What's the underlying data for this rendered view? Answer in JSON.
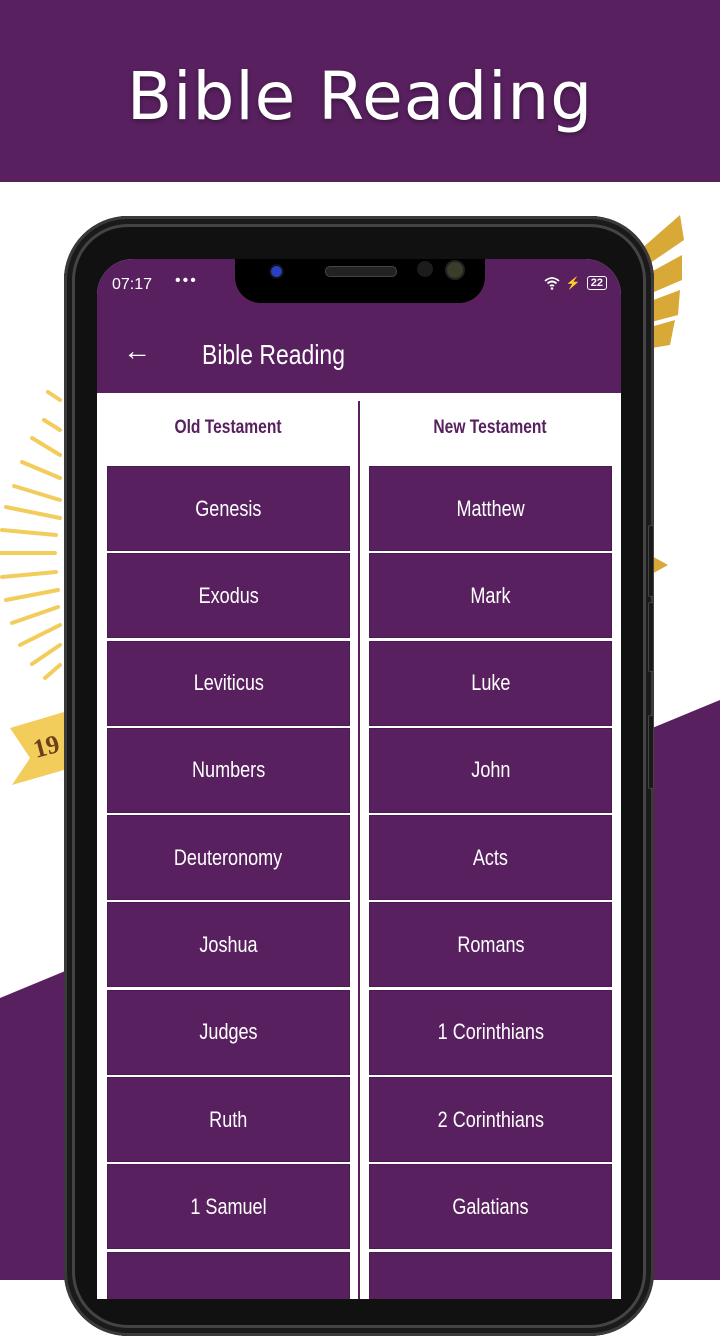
{
  "banner": {
    "title": "Bible Reading"
  },
  "colors": {
    "brand": "#58205f",
    "accent_gold": "#f2cd5c"
  },
  "decor": {
    "ribbon_text": "19"
  },
  "status_bar": {
    "time": "07:17",
    "dots": "•••",
    "wifi_icon": "wifi-icon",
    "charging_icon": "⚡",
    "battery": "22"
  },
  "app_bar": {
    "back_icon": "←",
    "title": "Bible Reading"
  },
  "columns": {
    "old": {
      "header": "Old Testament",
      "books": [
        "Genesis",
        "Exodus",
        "Leviticus",
        "Numbers",
        "Deuteronomy",
        "Joshua",
        "Judges",
        "Ruth",
        "1 Samuel",
        ""
      ]
    },
    "new": {
      "header": "New Testament",
      "books": [
        "Matthew",
        "Mark",
        "Luke",
        "John",
        "Acts",
        "Romans",
        "1 Corinthians",
        "2 Corinthians",
        "Galatians",
        ""
      ]
    }
  }
}
